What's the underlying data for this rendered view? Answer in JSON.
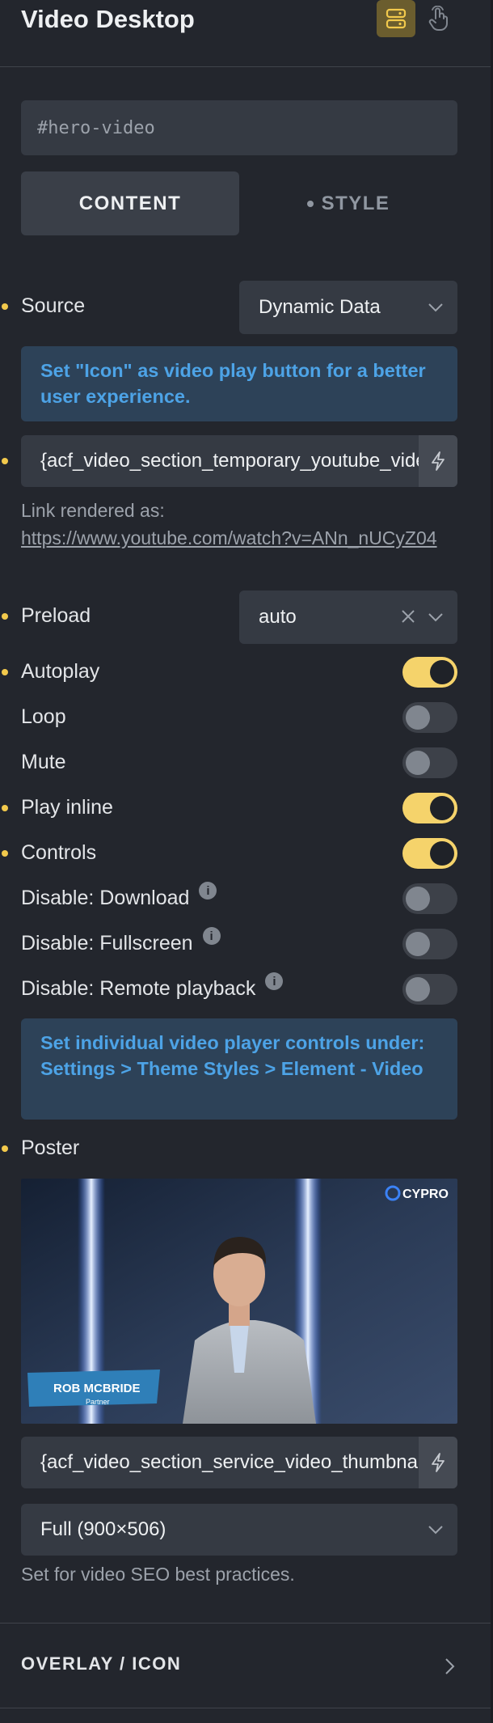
{
  "header": {
    "title": "Video Desktop"
  },
  "selector": {
    "value": "#hero-video"
  },
  "tabs": {
    "content": "CONTENT",
    "style": "STYLE"
  },
  "source": {
    "label": "Source",
    "value": "Dynamic Data"
  },
  "notice_icon": {
    "text": "Set \"Icon\" as video play button for a better user experience."
  },
  "video_field": {
    "value": "{acf_video_section_temporary_youtube_video_url}"
  },
  "link_note": {
    "prefix": "Link rendered as:",
    "url": "https://www.youtube.com/watch?v=ANn_nUCyZ04"
  },
  "preload": {
    "label": "Preload",
    "value": "auto"
  },
  "toggles": {
    "autoplay": {
      "label": "Autoplay",
      "on": true
    },
    "loop": {
      "label": "Loop",
      "on": false
    },
    "mute": {
      "label": "Mute",
      "on": false
    },
    "play_inline": {
      "label": "Play inline",
      "on": true
    },
    "controls": {
      "label": "Controls",
      "on": true
    },
    "disable_download": {
      "label": "Disable: Download",
      "on": false
    },
    "disable_fullscreen": {
      "label": "Disable: Fullscreen",
      "on": false
    },
    "disable_remote": {
      "label": "Disable: Remote playback",
      "on": false
    }
  },
  "notice_controls": {
    "text": "Set individual video player controls under: Settings > Theme Styles > Element - Video"
  },
  "poster": {
    "label": "Poster",
    "image": {
      "brand": "CYPRO",
      "name": "ROB MCBRIDE",
      "role": "Partner"
    },
    "field_value": "{acf_video_section_service_video_thumbnail}",
    "size": "Full (900×506)",
    "note": "Set for video SEO best practices."
  },
  "sections": {
    "overlay": "OVERLAY / ICON"
  },
  "colors": {
    "accent": "#f2c94c",
    "toggle_on": "#f5d36b",
    "notice_text": "#4da3e6",
    "notice_bg": "#2d4258",
    "panel_bg": "#23262d"
  },
  "icons": {
    "header_active": "layout-icon",
    "header_plain": "pointer-hand-icon",
    "dynamic": "lightning-bolt-icon",
    "chevron": "chevron-down-icon",
    "clear": "close-icon",
    "info": "info-icon",
    "section": "chevron-right-icon"
  }
}
